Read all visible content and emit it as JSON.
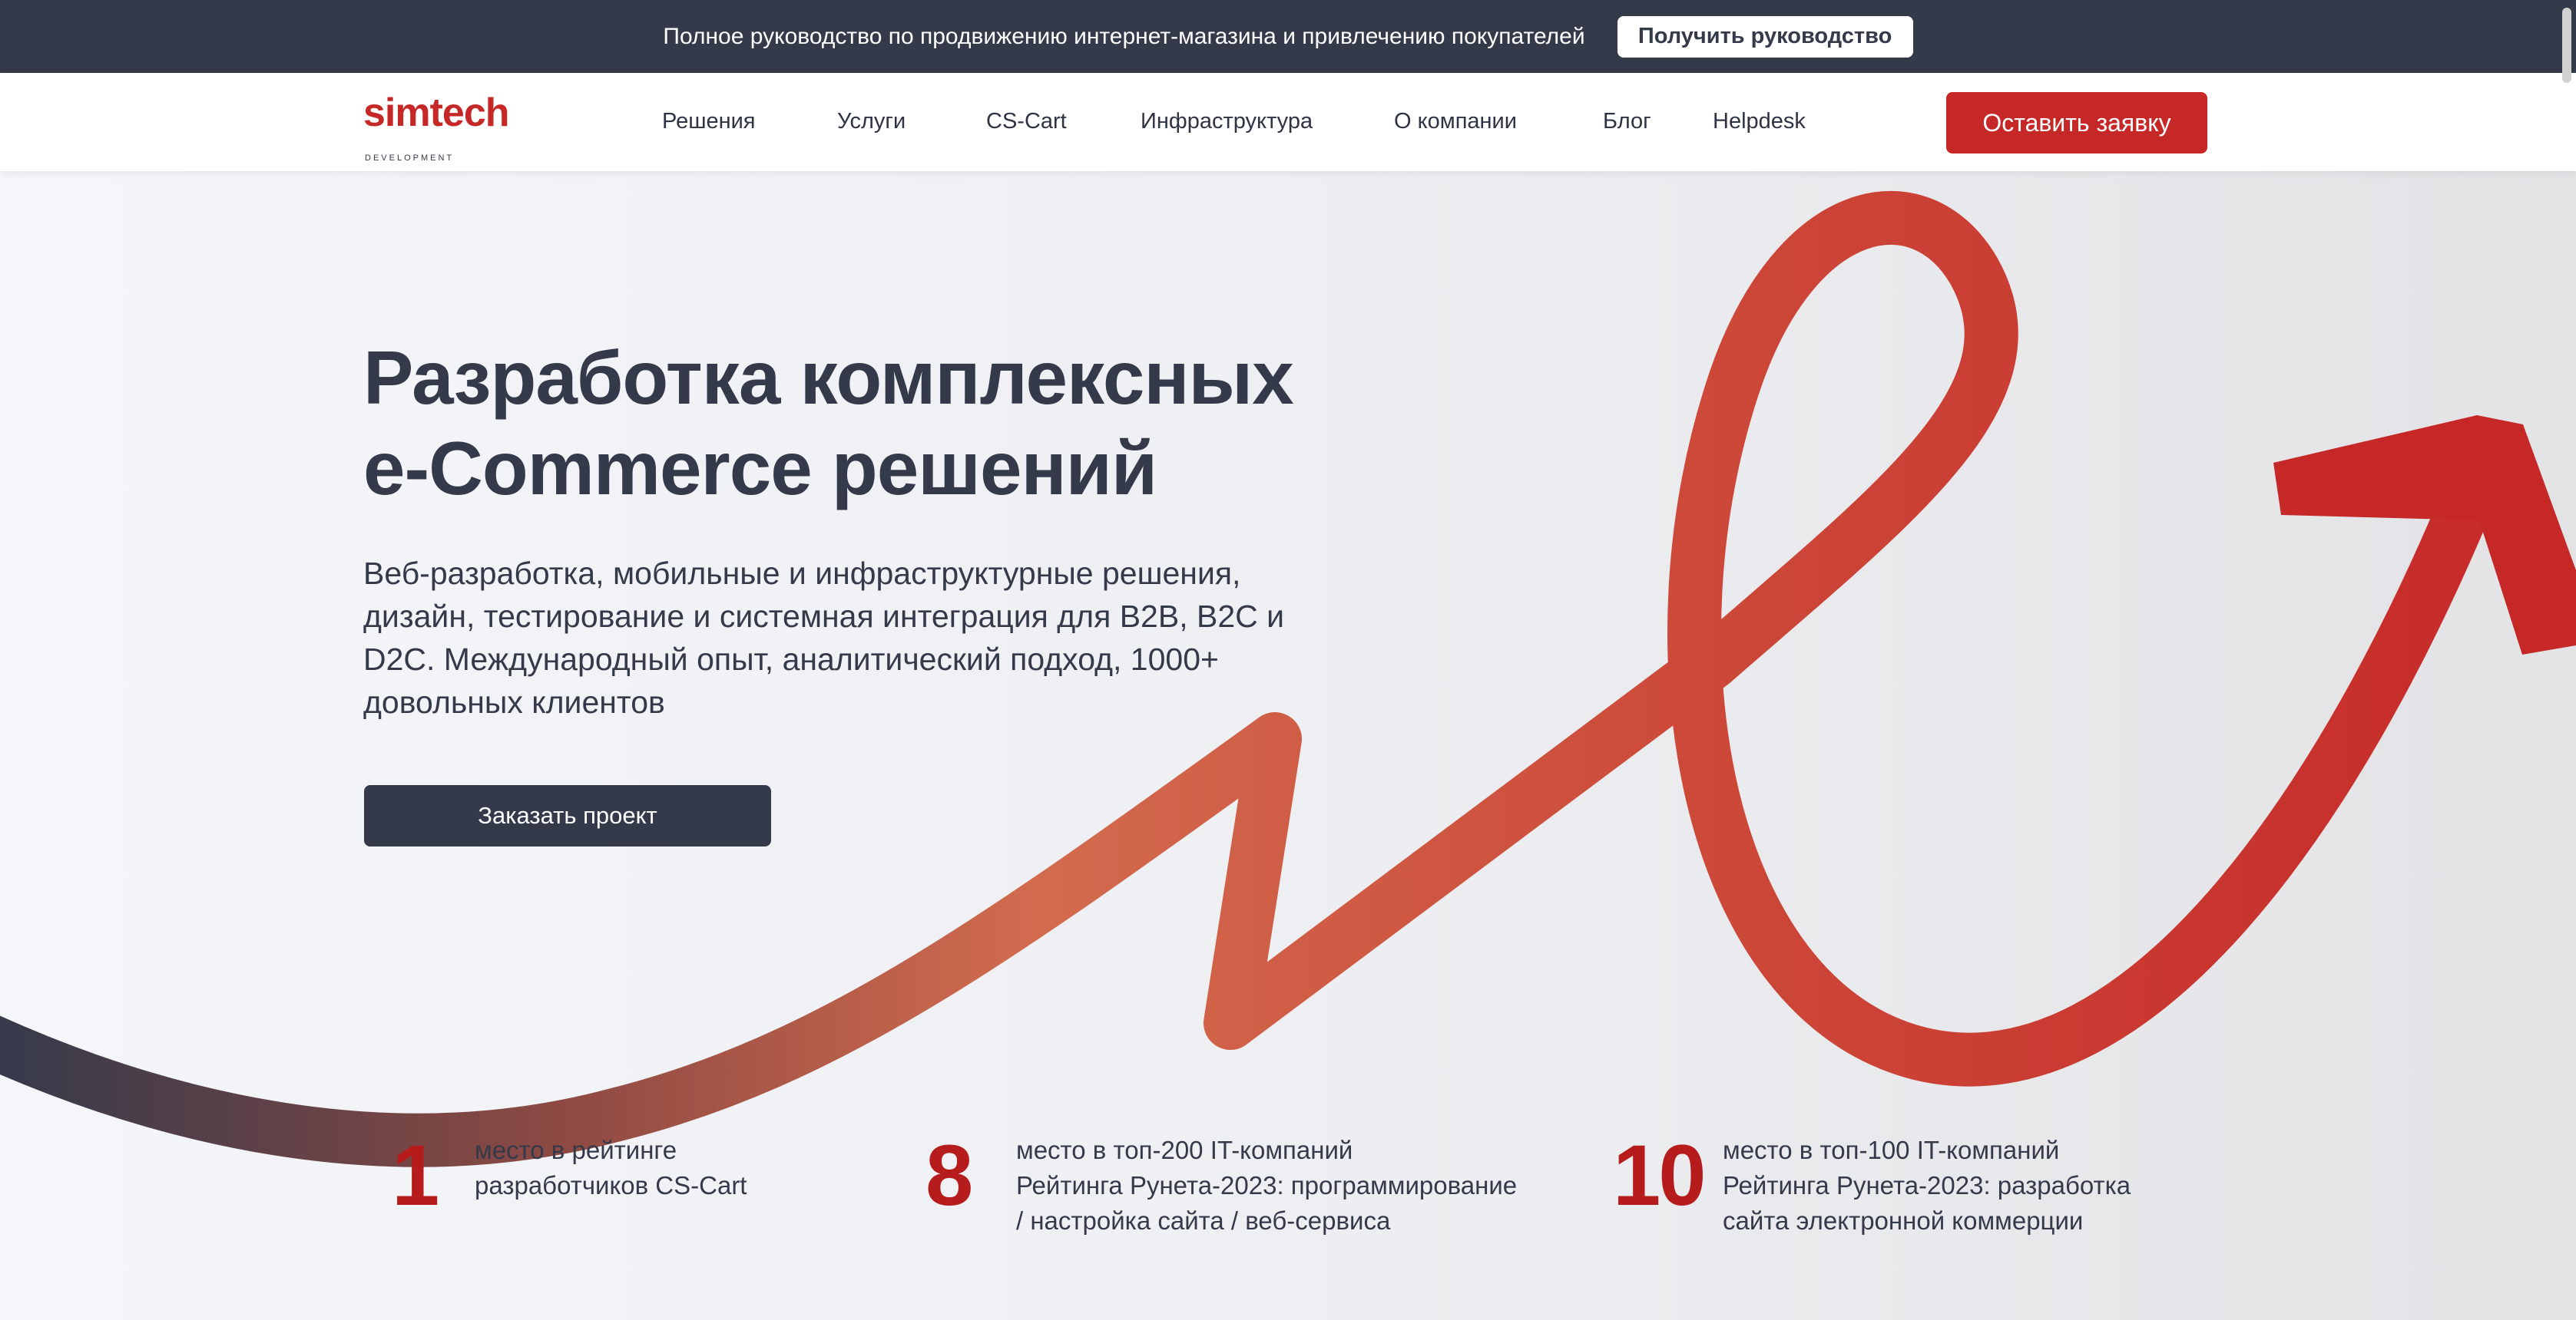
{
  "topbar": {
    "text": "Полное руководство по продвижению интернет-магазина и привлечению покупателей",
    "button": "Получить руководство"
  },
  "header": {
    "logo": {
      "main": "simtech",
      "sub": "DEVELOPMENT"
    },
    "nav": [
      "Решения",
      "Услуги",
      "CS-Cart",
      "Инфраструктура",
      "О компании",
      "Блог",
      "Helpdesk"
    ],
    "cta": "Оставить заявку"
  },
  "hero": {
    "title_line1": "Разработка комплексных",
    "title_line2": "e-Commerce решений",
    "description": "Веб-разработка, мобильные и инфраструктурные решения, дизайн, тестирование и системная интеграция для B2B, B2C и D2C. Международный опыт, аналитический подход, 1000+ довольных клиентов",
    "button": "Заказать проект"
  },
  "stats": [
    {
      "number": "1",
      "lines": [
        "место в рейтинге",
        "разработчиков CS-Cart"
      ]
    },
    {
      "number": "8",
      "lines": [
        "место в топ-200 IT-компаний",
        "Рейтинга Рунета-2023: программирование",
        "/ настройка сайта / веб-сервиса"
      ]
    },
    {
      "number": "10",
      "lines": [
        "место в топ-100 IT-компаний",
        "Рейтинга Рунета-2023: разработка",
        "сайта электронной коммерции"
      ]
    }
  ],
  "colors": {
    "brand_red": "#c62828",
    "dark": "#353a4b",
    "ribbon_start": "#353a4b",
    "ribbon_mid": "#d26b4e",
    "ribbon_end": "#c62828"
  }
}
